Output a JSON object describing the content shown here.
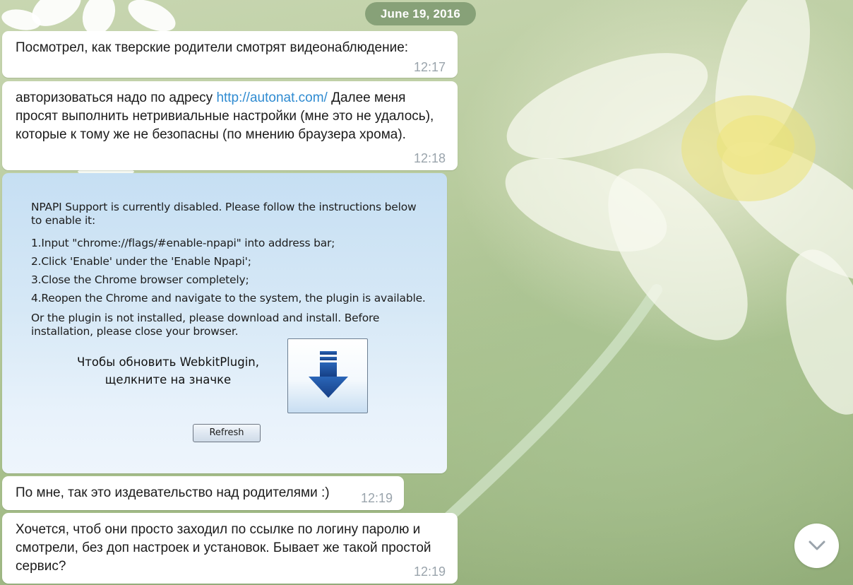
{
  "date_header": "June 19, 2016",
  "messages": [
    {
      "text": "Посмотрел, как тверские родители смотрят видеонаблюдение:",
      "time": "12:17"
    },
    {
      "text_before_link": "авторизоваться надо по адресу ",
      "link": "http://autonat.com/",
      "text_after_link": " Далее меня просят выполнить нетривиальные настройки (мне это не удалось), которые к тому же не безопасны (по мнению браузера хрома).",
      "time": "12:18"
    },
    {
      "text": "По мне, так это издевательство над родителями :)",
      "time": "12:19"
    },
    {
      "text": "Хочется, чтоб они просто заходил по ссылке по логину паролю и смотрели, без доп настроек и установок. Бывает же такой простой сервис?",
      "time": "12:19"
    }
  ],
  "image_message": {
    "npapi_notice": "NPAPI Support is currently disabled. Please follow the instructions below to enable it:",
    "steps": [
      "1.Input \"chrome://flags/#enable-npapi\" into address bar;",
      "2.Click 'Enable' under the 'Enable Npapi';",
      "3.Close the Chrome browser completely;",
      "4.Reopen the Chrome and navigate to the system, the plugin is available."
    ],
    "install_notice": "Or the plugin is not installed, please download and install. Before installation, please close your browser.",
    "update_prompt_line1": "Чтобы обновить WebkitPlugin,",
    "update_prompt_line2": "щелкните на значке",
    "refresh_label": "Refresh",
    "download_icon": "download-arrow-icon"
  },
  "scroll_button_icon": "chevron-down-icon",
  "colors": {
    "date_pill": "#7a966c",
    "link": "#2f8bd1",
    "time": "#9aa4ac",
    "bubble": "#ffffff",
    "download_arrow": "#1f56a8"
  }
}
